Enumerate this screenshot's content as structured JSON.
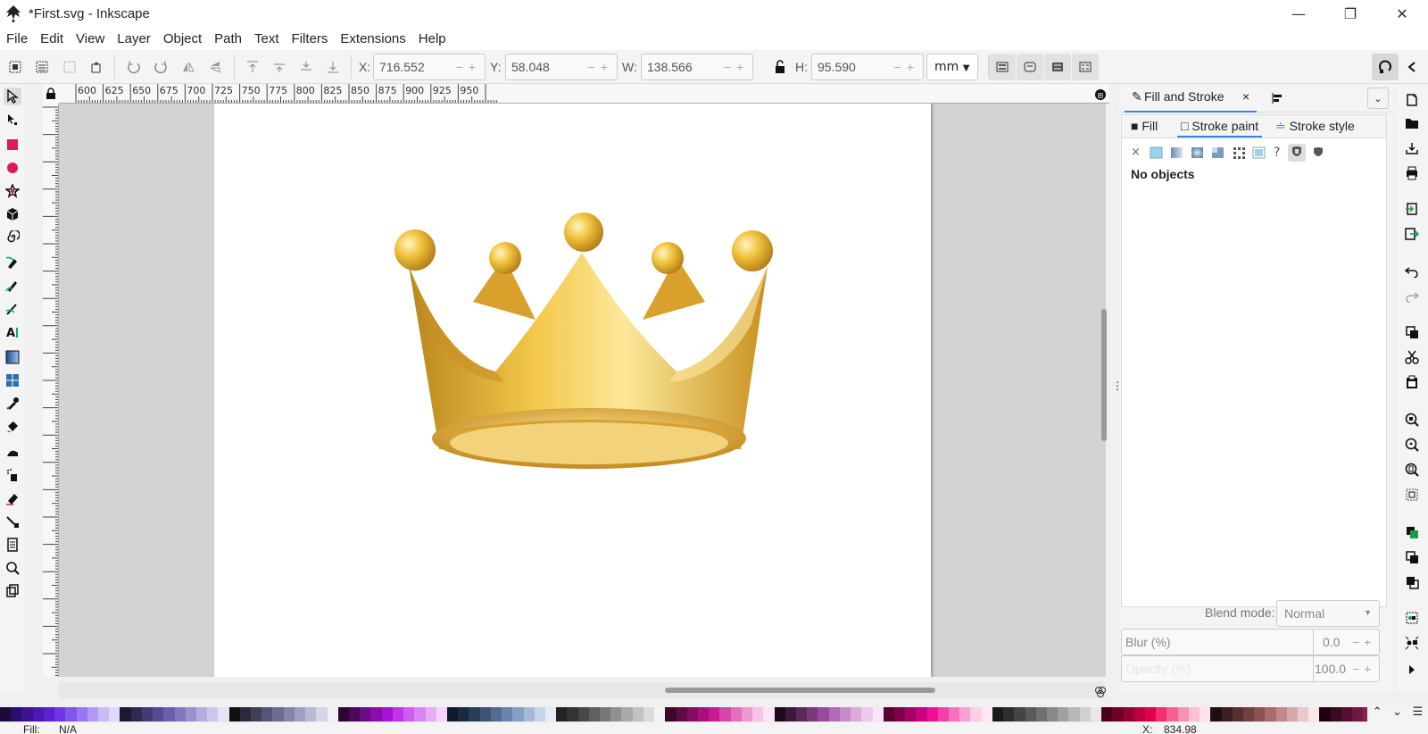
{
  "window": {
    "title": "*First.svg - Inkscape",
    "minimize": "—",
    "maximize": "❐",
    "close": "✕"
  },
  "menu": [
    "File",
    "Edit",
    "View",
    "Layer",
    "Object",
    "Path",
    "Text",
    "Filters",
    "Extensions",
    "Help"
  ],
  "tool_controls": {
    "x_label": "X:",
    "x_value": "716.552",
    "y_label": "Y:",
    "y_value": "58.048",
    "w_label": "W:",
    "w_value": "138.566",
    "h_label": "H:",
    "h_value": "95.590",
    "unit": "mm"
  },
  "ruler": {
    "labels": [
      "600",
      "625",
      "650",
      "675",
      "700",
      "725",
      "750",
      "775",
      "800",
      "825",
      "850",
      "875",
      "900",
      "925",
      "950"
    ]
  },
  "dock": {
    "tab_fill_stroke": "Fill and Stroke",
    "tab_close": "×",
    "fill_tab": "Fill",
    "stroke_paint_tab": "Stroke paint",
    "stroke_style_tab": "Stroke style",
    "no_paint_symbol": "×",
    "unknown_symbol": "?",
    "no_objects": "No objects",
    "blend_label": "Blend mode:",
    "blend_value": "Normal",
    "blur_label": "Blur (%)",
    "blur_value": "0.0",
    "opacity_label": "Opacity (%)",
    "opacity_value": "100.0"
  },
  "status": {
    "fill_label": "Fill:",
    "fill_value": "N/A",
    "coord_label": "X:",
    "coord_value": "834.98"
  },
  "colors": {
    "accent": "#3584e4",
    "canvas_bg": "#d3d3d3",
    "crown_gold": "#e8b93a"
  },
  "palette": [
    "#1a0b3a",
    "#2b0d6b",
    "#3d1290",
    "#4c1ab0",
    "#5d22d0",
    "#6f33e8",
    "#8455ee",
    "#9a77f2",
    "#b199f5",
    "#c8bbf8",
    "#e0d9fb",
    "#1c1a2e",
    "#2f2a50",
    "#423a72",
    "#554b94",
    "#6a5fae",
    "#8178c0",
    "#9992cf",
    "#b2adde",
    "#cbc8ea",
    "#e5e3f5",
    "#101010",
    "#2a2a3a",
    "#3f3f58",
    "#555575",
    "#6c6c92",
    "#8585aa",
    "#9f9fc0",
    "#babad5",
    "#d5d5e8",
    "#f0f0f8",
    "#2a0830",
    "#4a0a5a",
    "#6a0c85",
    "#8a0eae",
    "#a812d2",
    "#c033e8",
    "#ce5cee",
    "#da85f3",
    "#e6adf7",
    "#f2d6fb",
    "#0d1a2a",
    "#1a2a3f",
    "#2a3d58",
    "#3d5275",
    "#536a92",
    "#6c84ad",
    "#889fc5",
    "#a6bad8",
    "#c6d4ea",
    "#e5ecf7",
    "#222222",
    "#333333",
    "#484848",
    "#5f5f5f",
    "#777777",
    "#909090",
    "#a9a9a9",
    "#c2c2c2",
    "#dbdbdb",
    "#f3f3f3",
    "#3a0a2a",
    "#5e0c45",
    "#830e60",
    "#a8107b",
    "#c81a93",
    "#d944a8",
    "#e46ebd",
    "#ee99d2",
    "#f6c3e6",
    "#fbe4f3",
    "#1a0a1a",
    "#3a1a3a",
    "#5a2a5a",
    "#7a3a7a",
    "#9a4a9a",
    "#b46ab4",
    "#c98ac9",
    "#dbaadb",
    "#eccaec",
    "#f8e6f8",
    "#5a0030",
    "#80004a",
    "#a60064",
    "#cc007e",
    "#ec1096",
    "#f540a8",
    "#fa70bc",
    "#fda0d2",
    "#ffcfe8",
    "#ffe8f3",
    "#1a1a1a",
    "#2e2e2e",
    "#444444",
    "#5a5a5a",
    "#707070",
    "#888888",
    "#a0a0a0",
    "#b8b8b8",
    "#d0d0d0",
    "#e8e8e8",
    "#4a0018",
    "#700026",
    "#960034",
    "#bc0042",
    "#e00052",
    "#f03070",
    "#f86090",
    "#fc90b2",
    "#fec0d4",
    "#ffe2ec",
    "#1e1010",
    "#3a2020",
    "#563030",
    "#724040",
    "#8e5050",
    "#a86a6a",
    "#c08888",
    "#d6a8a8",
    "#eacaca",
    "#f8e8e8",
    "#200010",
    "#3a0820",
    "#551030",
    "#701840",
    "#8a2050",
    "#a54068",
    "#bd6884",
    "#d394a6",
    "#e8c0cc",
    "#f6e2e8"
  ]
}
